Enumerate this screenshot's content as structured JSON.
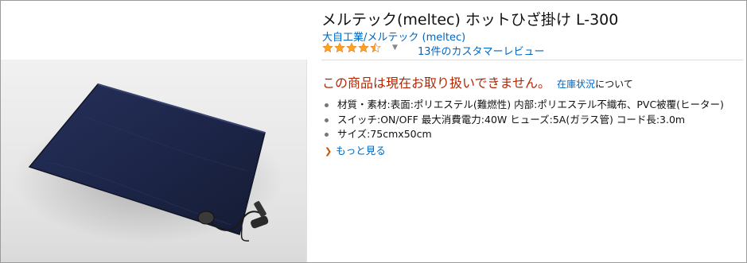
{
  "product": {
    "title": "メルテック(meltec) ホットひざ掛け L-300",
    "brand_link": "大自工業/メルテック (meltec)",
    "rating": {
      "stars": 4.5,
      "caret_icon": "dropdown-caret-icon",
      "review_link": "13件のカスタマーレビュー"
    },
    "availability": {
      "message": "この商品は現在お取り扱いできません。",
      "stock_link": "在庫状況",
      "stock_suffix": "について"
    },
    "features": [
      "材質・素材:表面:ポリエステル(難燃性) 内部:ポリエステル不織布、PVC被覆(ヒーター)",
      "スイッチ:ON/OFF 最大消費電力:40W ヒューズ:5A(ガラス管) コード長:3.0m",
      "サイズ:75cmx50cm"
    ],
    "more_link": "もっと見る"
  },
  "colors": {
    "link": "#0066c0",
    "unavailable": "#b12704",
    "star": "#ffa41c",
    "blanket": "#1c2544"
  }
}
